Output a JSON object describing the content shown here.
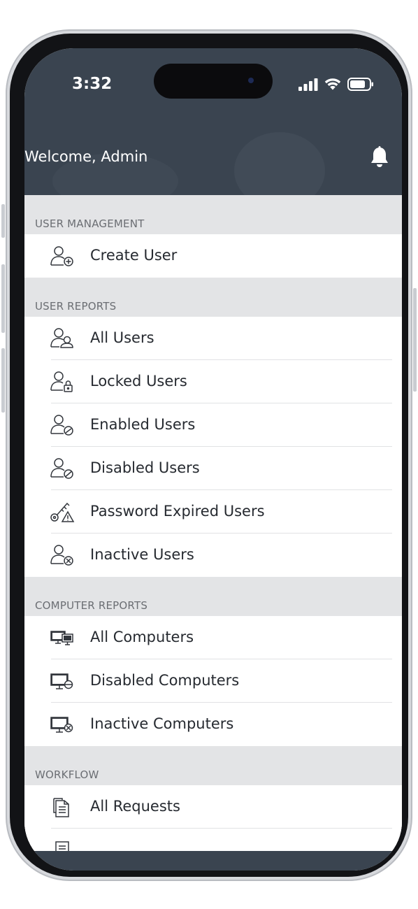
{
  "status_bar": {
    "time": "3:32"
  },
  "header": {
    "welcome": "Welcome, Admin"
  },
  "sections": [
    {
      "title": "USER MANAGEMENT",
      "items": [
        {
          "label": "Create User",
          "icon": "user-add-icon"
        }
      ]
    },
    {
      "title": "USER REPORTS",
      "items": [
        {
          "label": "All Users",
          "icon": "users-icon"
        },
        {
          "label": "Locked Users",
          "icon": "user-lock-icon"
        },
        {
          "label": "Enabled Users",
          "icon": "user-enabled-icon"
        },
        {
          "label": "Disabled Users",
          "icon": "user-disabled-icon"
        },
        {
          "label": "Password Expired Users",
          "icon": "key-warning-icon"
        },
        {
          "label": "Inactive Users",
          "icon": "user-inactive-icon"
        }
      ]
    },
    {
      "title": "COMPUTER REPORTS",
      "items": [
        {
          "label": "All Computers",
          "icon": "computers-icon"
        },
        {
          "label": "Disabled Computers",
          "icon": "computer-disabled-icon"
        },
        {
          "label": "Inactive Computers",
          "icon": "computer-inactive-icon"
        }
      ]
    },
    {
      "title": "WORKFLOW",
      "items": [
        {
          "label": "All Requests",
          "icon": "documents-icon"
        }
      ]
    }
  ],
  "colors": {
    "header_bg": "#3a4450",
    "section_bg": "#e3e4e6",
    "text": "#262a30"
  }
}
